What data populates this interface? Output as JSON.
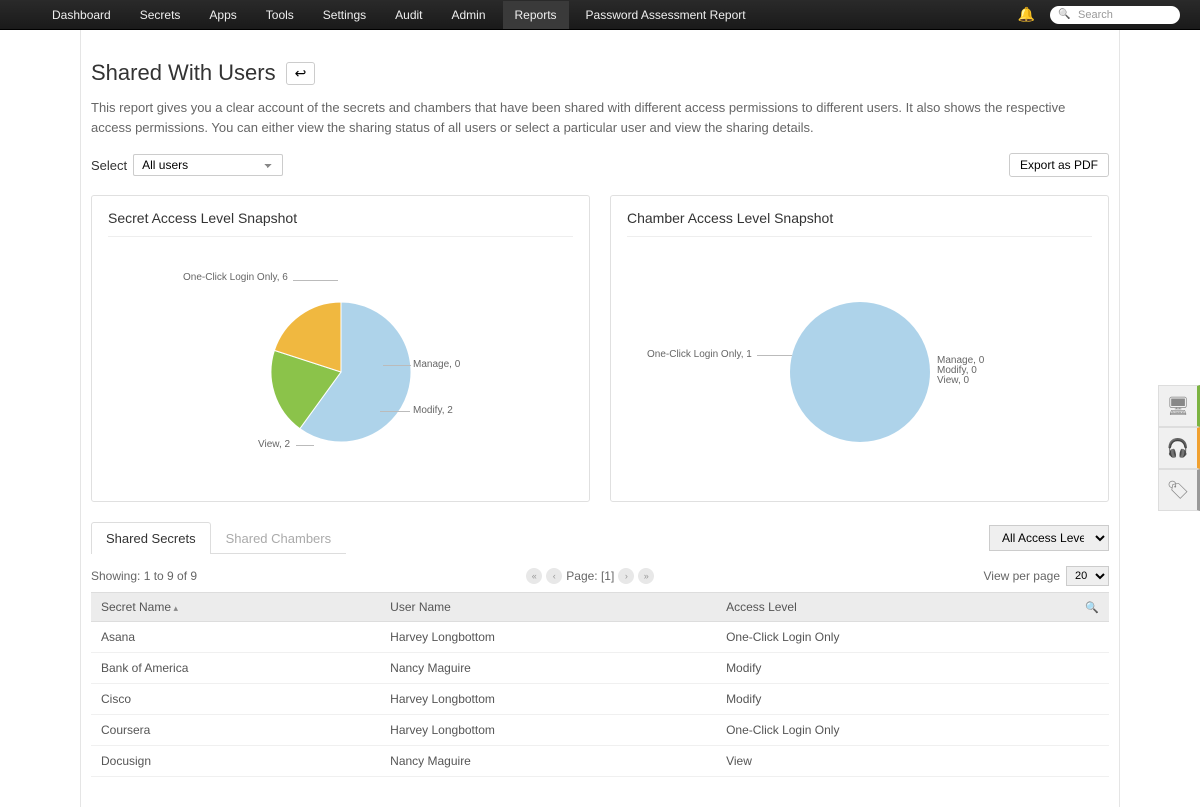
{
  "nav": {
    "items": [
      "Dashboard",
      "Secrets",
      "Apps",
      "Tools",
      "Settings",
      "Audit",
      "Admin",
      "Reports",
      "Password Assessment Report"
    ],
    "active_index": 7,
    "search_placeholder": "Search"
  },
  "page": {
    "title": "Shared With Users",
    "description": "This report gives you a clear account of the secrets and chambers that have been shared with different access permissions to different users. It also shows the respective access permissions. You can either view the sharing status of all users or select a particular user and view the sharing details."
  },
  "controls": {
    "select_label": "Select",
    "user_selected": "All users",
    "export_label": "Export as PDF"
  },
  "chart_data": [
    {
      "type": "pie",
      "title": "Secret Access Level Snapshot",
      "series": [
        {
          "name": "One-Click Login Only",
          "value": 6,
          "color": "#aed3ea"
        },
        {
          "name": "Manage",
          "value": 0,
          "color": "#d0d0d0"
        },
        {
          "name": "Modify",
          "value": 2,
          "color": "#8bc34a"
        },
        {
          "name": "View",
          "value": 2,
          "color": "#f0b840"
        }
      ]
    },
    {
      "type": "pie",
      "title": "Chamber Access Level Snapshot",
      "series": [
        {
          "name": "One-Click Login Only",
          "value": 1,
          "color": "#aed3ea"
        },
        {
          "name": "Manage",
          "value": 0,
          "color": "#d0d0d0"
        },
        {
          "name": "Modify",
          "value": 0,
          "color": "#8bc34a"
        },
        {
          "name": "View",
          "value": 0,
          "color": "#f0b840"
        }
      ]
    }
  ],
  "tabs": {
    "items": [
      "Shared Secrets",
      "Shared Chambers"
    ],
    "active_index": 0,
    "access_filter": "All Access Level"
  },
  "table": {
    "showing": "Showing: 1 to 9 of 9",
    "page_label": "Page: [1]",
    "vpp_label": "View per page",
    "vpp_value": "20",
    "columns": [
      "Secret Name",
      "User Name",
      "Access Level"
    ],
    "rows": [
      {
        "secret": "Asana",
        "user": "Harvey Longbottom",
        "access": "One-Click Login Only"
      },
      {
        "secret": "Bank of America",
        "user": "Nancy Maguire",
        "access": "Modify"
      },
      {
        "secret": "Cisco",
        "user": "Harvey Longbottom",
        "access": "Modify"
      },
      {
        "secret": "Coursera",
        "user": "Harvey Longbottom",
        "access": "One-Click Login Only"
      },
      {
        "secret": "Docusign",
        "user": "Nancy Maguire",
        "access": "View"
      }
    ]
  }
}
